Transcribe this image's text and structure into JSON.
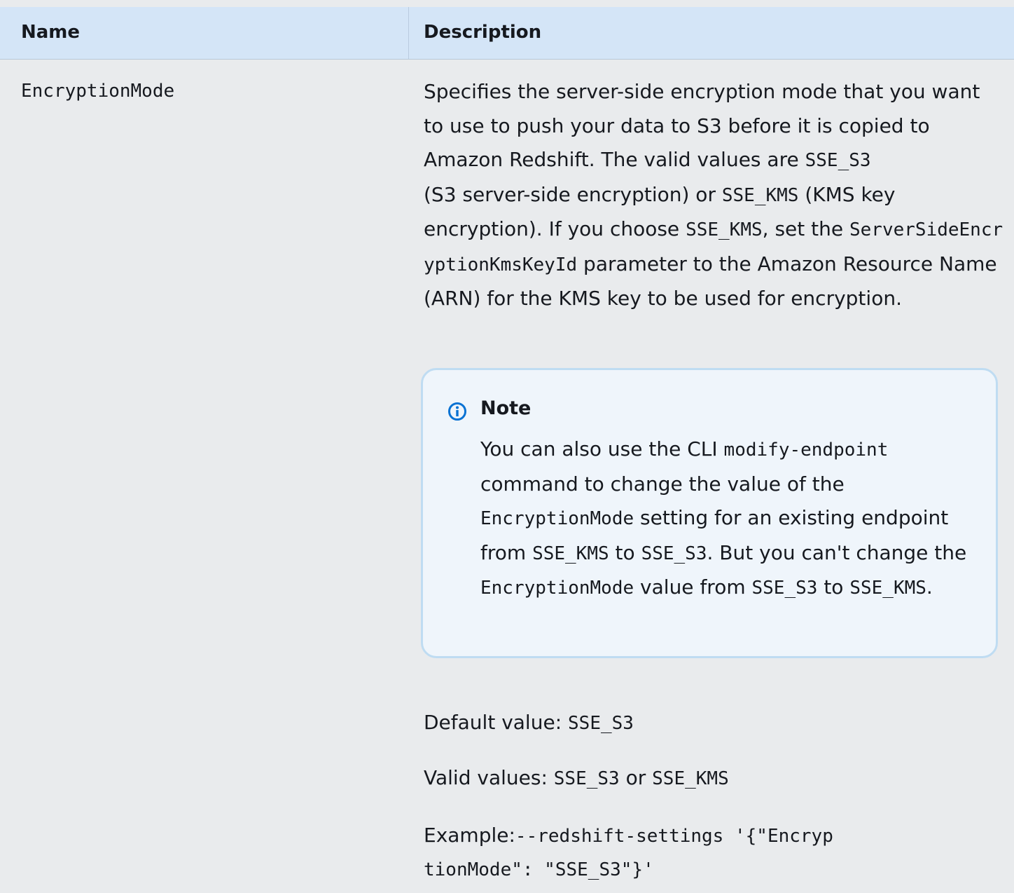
{
  "table": {
    "headers": {
      "name": "Name",
      "description": "Description"
    },
    "row": {
      "name": "EncryptionMode",
      "description": {
        "part1": "Specifies the server-side encryption mode that you want to use to push your data to S3 before it is copied to Amazon Redshift. The valid values are ",
        "code1": "SSE_S3",
        "part2": " (S3 server-side encryption) or ",
        "code2": "SSE_KMS",
        "part3": " (KMS key encryption). If you choose ",
        "code3": "SSE_KMS",
        "part4": ", set the ",
        "code4": "ServerSideEncryptionKmsKeyId",
        "part5": " parameter to the Amazon Resource Name (ARN) for the KMS key to be used for encryption."
      },
      "note": {
        "title": "Note",
        "part1": "You can also use the CLI ",
        "code1": "modify-endpoint",
        "part2": " command to change the value of the ",
        "code2": "EncryptionMode",
        "part3": " setting for an existing endpoint from ",
        "code3": "SSE_KMS",
        "part4": " to ",
        "code4": "SSE_S3",
        "part5": ". But you can't change the ",
        "code5": "EncryptionMode",
        "part6": " value from ",
        "code6": "SSE_S3",
        "part7": " to ",
        "code7": "SSE_KMS",
        "part8": ".",
        "icon": "info-icon",
        "accent_color": "#0972d3"
      },
      "default_value": {
        "label": "Default value: ",
        "value": "SSE_S3"
      },
      "valid_values": {
        "label": "Valid values: ",
        "value1": "SSE_S3",
        "or": " or ",
        "value2": "SSE_KMS"
      },
      "example": {
        "label": "Example:",
        "code_line1": "--redshift-settings '{\"Encryp",
        "code_line2": "tionMode\": \"SSE_S3\"}'"
      }
    }
  },
  "colors": {
    "header_bg": "#d4e5f7",
    "body_bg": "#e9ebed",
    "note_bg": "#eff5fb",
    "note_border": "#bfdcf2"
  }
}
